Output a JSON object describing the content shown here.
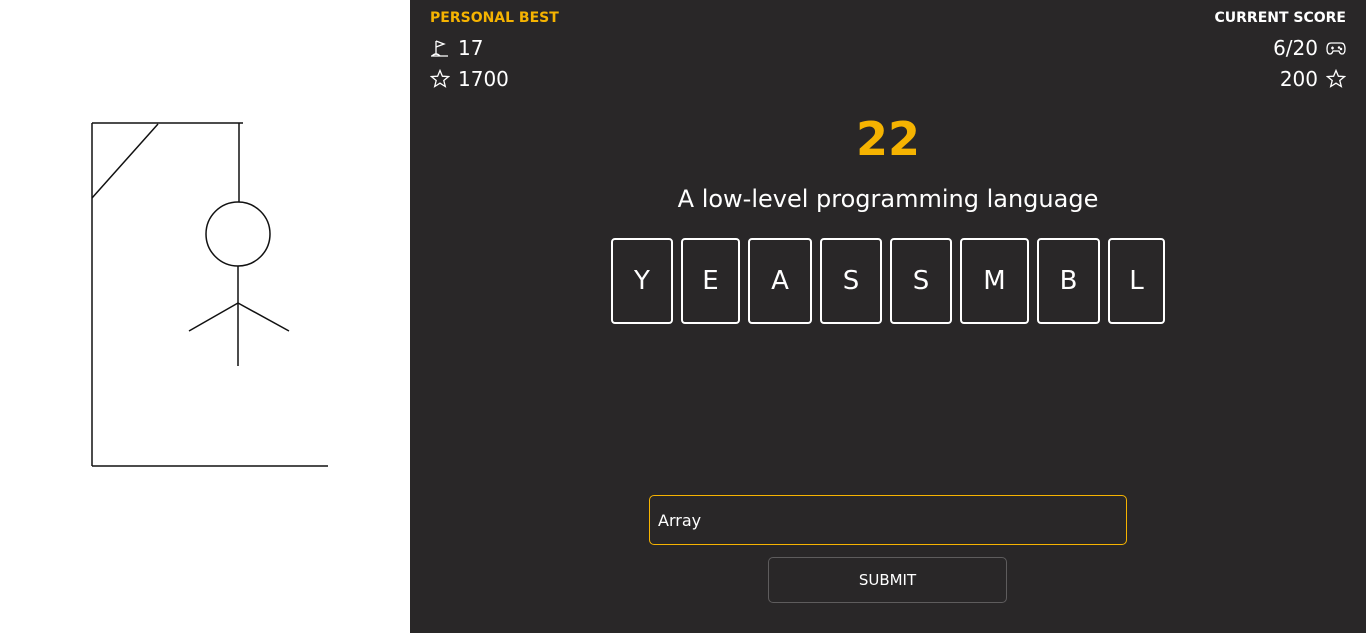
{
  "colors": {
    "accent": "#f5b301",
    "panel_bg": "#292728",
    "left_bg": "#ffffff",
    "text": "#ffffff"
  },
  "personal_best": {
    "label": "PERSONAL BEST",
    "level_icon": "flag-icon",
    "level": "17",
    "points_icon": "star-icon",
    "points": "1700"
  },
  "current_score": {
    "label": "CURRENT SCORE",
    "progress": "6/20",
    "progress_icon": "gamepad-icon",
    "points": "200",
    "points_icon": "star-icon"
  },
  "game": {
    "timer": "22",
    "hint": "A low-level programming language",
    "tiles": [
      "Y",
      "E",
      "A",
      "S",
      "S",
      "M",
      "B",
      "L"
    ],
    "hangman_parts_drawn": [
      "gallows",
      "head",
      "body",
      "left-arm",
      "right-arm"
    ]
  },
  "form": {
    "answer_value": "Array",
    "submit_label": "SUBMIT"
  }
}
